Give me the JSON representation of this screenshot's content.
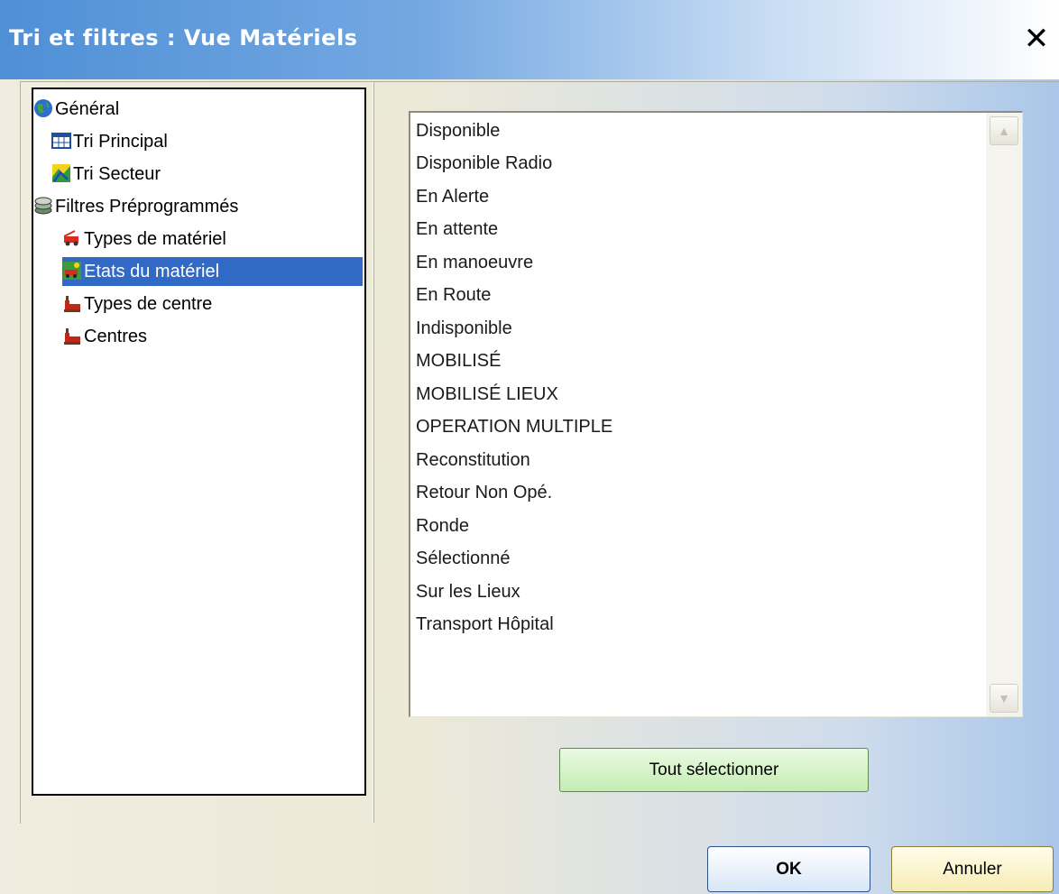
{
  "window": {
    "title": "Tri et filtres : Vue Matériels",
    "close_symbol": "✕"
  },
  "tree": {
    "items": [
      {
        "label": "Général",
        "icon": "globe-icon",
        "level": 0,
        "selected": false
      },
      {
        "label": "Tri Principal",
        "icon": "grid-icon",
        "level": 1,
        "selected": false
      },
      {
        "label": "Tri Secteur",
        "icon": "map-icon",
        "level": 1,
        "selected": false
      },
      {
        "label": "Filtres Préprogrammés",
        "icon": "filter-stack-icon",
        "level": 0,
        "selected": false
      },
      {
        "label": "Types de matériel",
        "icon": "vehicle-icon",
        "level": 1,
        "selected": false
      },
      {
        "label": "Etats du matériel",
        "icon": "vehicle-state-icon",
        "level": 1,
        "selected": true
      },
      {
        "label": "Types de centre",
        "icon": "station-icon",
        "level": 1,
        "selected": false
      },
      {
        "label": "Centres",
        "icon": "station-icon",
        "level": 1,
        "selected": false
      }
    ]
  },
  "states_list": {
    "items": [
      "Disponible",
      "Disponible Radio",
      "En Alerte",
      "En attente",
      "En manoeuvre",
      "En Route",
      "Indisponible",
      "MOBILISÉ",
      "MOBILISÉ LIEUX",
      "OPERATION MULTIPLE",
      "Reconstitution",
      "Retour Non Opé.",
      "Ronde",
      "Sélectionné",
      "Sur les Lieux",
      "Transport Hôpital"
    ],
    "scroll_up_symbol": "▲",
    "scroll_down_symbol": "▼"
  },
  "buttons": {
    "select_all": "Tout sélectionner",
    "ok": "OK",
    "cancel": "Annuler"
  },
  "colors": {
    "selection": "#316ac5",
    "titlebar": "#4f8fd6"
  }
}
